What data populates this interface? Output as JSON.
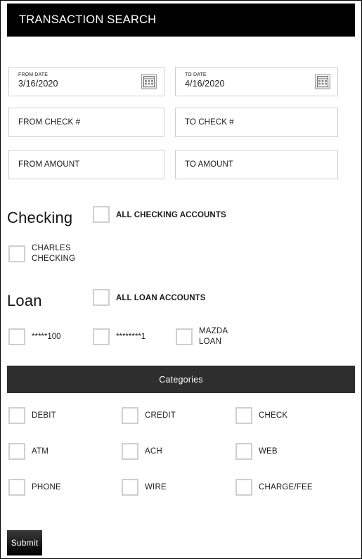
{
  "header": {
    "title": "TRANSACTION SEARCH"
  },
  "date_fields": [
    {
      "name": "from-date",
      "label": "FROM DATE",
      "value": "3/16/2020",
      "icon": "calendar-icon"
    },
    {
      "name": "to-date",
      "label": "TO DATE",
      "value": "4/16/2020",
      "icon": "calendar-icon"
    }
  ],
  "text_fields": [
    {
      "name": "from-check-number",
      "placeholder": "FROM CHECK #",
      "value": ""
    },
    {
      "name": "to-check-number",
      "placeholder": "TO CHECK #",
      "value": ""
    },
    {
      "name": "from-amount",
      "placeholder": "FROM AMOUNT",
      "value": ""
    },
    {
      "name": "to-amount",
      "placeholder": "TO AMOUNT",
      "value": ""
    }
  ],
  "checking": {
    "heading": "Checking",
    "all_label": "ALL CHECKING ACCOUNTS",
    "all_checked": false,
    "accounts": [
      {
        "label": "CHARLES\nCHECKING",
        "line1": "CHARLES",
        "line2": "CHECKING",
        "checked": false
      }
    ]
  },
  "loan": {
    "heading": "Loan",
    "all_label": "ALL LOAN ACCOUNTS",
    "all_checked": false,
    "accounts": [
      {
        "label": "*****100",
        "line1": "*****100",
        "line2": "",
        "checked": false
      },
      {
        "label": "********1",
        "line1": "********1",
        "line2": "",
        "checked": false
      },
      {
        "label": "MAZDA LOAN",
        "line1": "MAZDA",
        "line2": "LOAN",
        "checked": false
      }
    ]
  },
  "categories": {
    "title": "Categories",
    "items": [
      {
        "label": "DEBIT",
        "checked": false
      },
      {
        "label": "CREDIT",
        "checked": false
      },
      {
        "label": "CHECK",
        "checked": false
      },
      {
        "label": "ATM",
        "checked": false
      },
      {
        "label": "ACH",
        "checked": false
      },
      {
        "label": "WEB",
        "checked": false
      },
      {
        "label": "PHONE",
        "checked": false
      },
      {
        "label": "WIRE",
        "checked": false
      },
      {
        "label": "CHARGE/FEE",
        "checked": false
      }
    ]
  },
  "actions": {
    "submit_label": "Submit"
  },
  "colors": {
    "header_background": "#000000",
    "categories_background": "#2e2e2e",
    "submit_background": "#000000",
    "field_border": "#cfcfcf",
    "text": "#1b1b1b",
    "page_border": "#000000"
  }
}
